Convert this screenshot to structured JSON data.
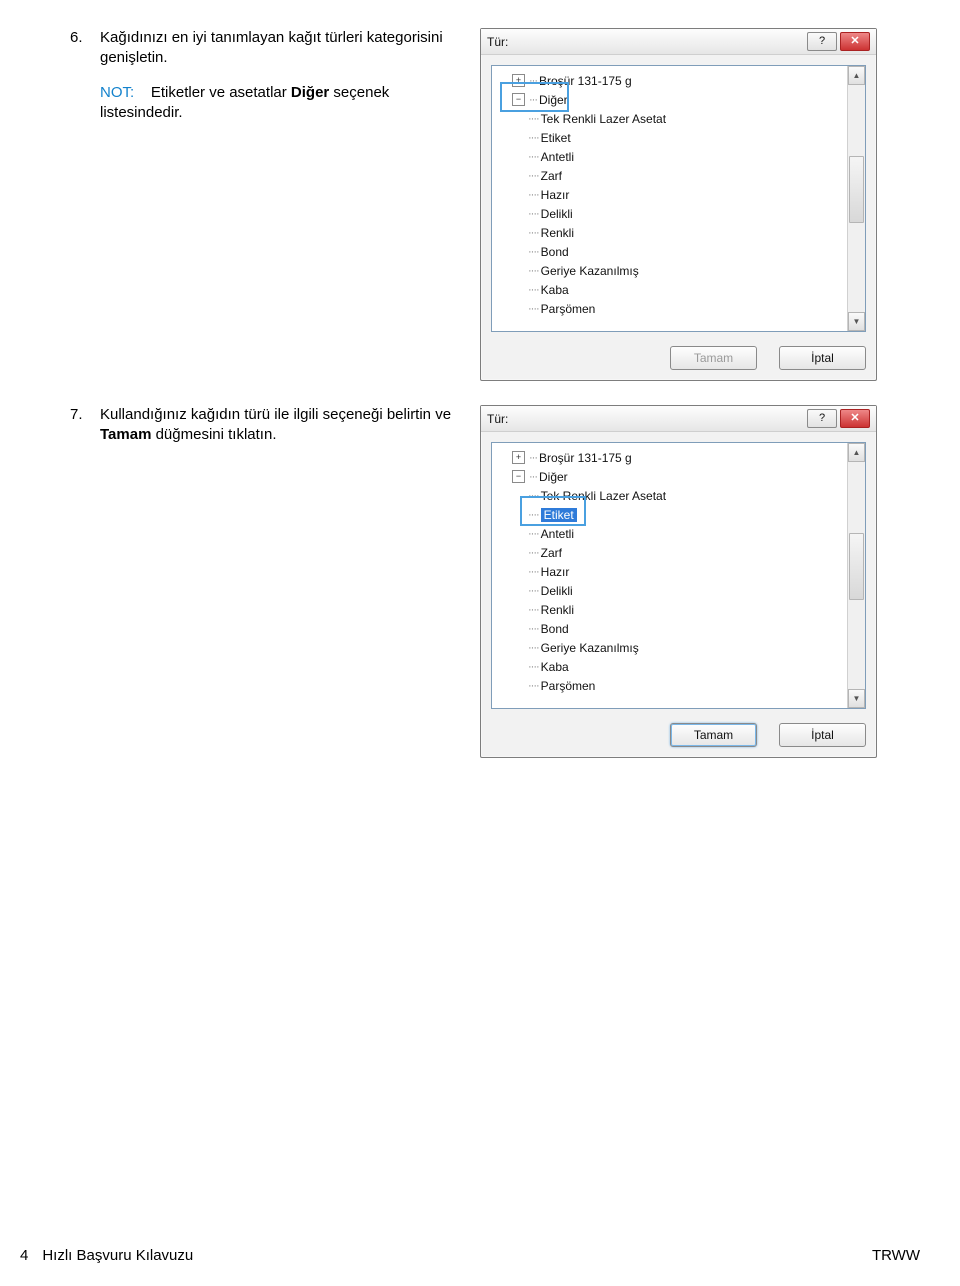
{
  "step6": {
    "number": "6.",
    "text_a": "Kağıdınızı en iyi tanımlayan kağıt türleri kategorisini genişletin.",
    "note_label": "NOT:",
    "note_text_a": "Etiketler ve asetatlar ",
    "note_bold": "Diğer",
    "note_text_b": " seçenek listesindedir."
  },
  "step7": {
    "number": "7.",
    "text_a": "Kullandığınız kağıdın türü ile ilgili seçeneği belirtin ve ",
    "bold": "Tamam",
    "text_b": " düğmesini tıklatın."
  },
  "dialog1": {
    "title": "Tür:",
    "help": "?",
    "close": "✕",
    "tree": {
      "node0": "Broşür 131-175 g",
      "node1": "Diğer",
      "items": [
        "Tek Renkli Lazer Asetat",
        "Etiket",
        "Antetli",
        "Zarf",
        "Hazır",
        "Delikli",
        "Renkli",
        "Bond",
        "Geriye Kazanılmış",
        "Kaba",
        "Parşömen"
      ]
    },
    "ok": "Tamam",
    "cancel": "İptal"
  },
  "dialog2": {
    "title": "Tür:",
    "help": "?",
    "close": "✕",
    "tree": {
      "node0": "Broşür 131-175 g",
      "node1": "Diğer",
      "items": [
        "Tek Renkli Lazer Asetat",
        "Etiket",
        "Antetli",
        "Zarf",
        "Hazır",
        "Delikli",
        "Renkli",
        "Bond",
        "Geriye Kazanılmış",
        "Kaba",
        "Parşömen"
      ]
    },
    "ok": "Tamam",
    "cancel": "İptal"
  },
  "footer": {
    "page_num": "4",
    "doc_title": "Hızlı Başvuru Kılavuzu",
    "right": "TRWW"
  }
}
